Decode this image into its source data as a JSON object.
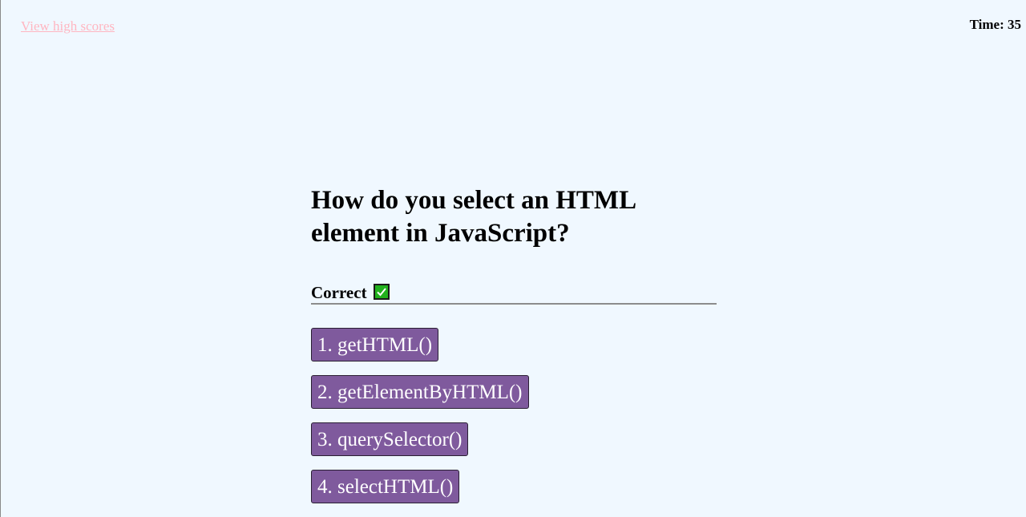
{
  "header": {
    "high_scores_link": "View high scores",
    "timer_text": "Time: 35"
  },
  "quiz": {
    "question": "How do you select an HTML element in JavaScript?",
    "feedback": "Correct",
    "feedback_icon": "check-mark-icon",
    "answers": [
      "1. getHTML()",
      "2. getElementByHTML()",
      "3. querySelector()",
      "4. selectHTML()"
    ]
  },
  "colors": {
    "background": "#f0f8ff",
    "link": "#ffb6c1",
    "button": "#7f5a9d",
    "check": "#21b11d"
  }
}
